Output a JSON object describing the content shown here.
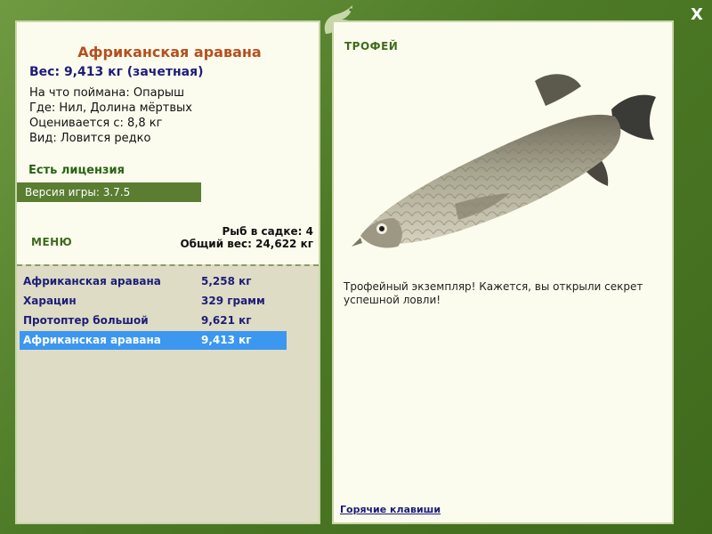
{
  "fish": {
    "name": "Африканская аравана",
    "weight_line": "Вес: 9,413 кг (зачетная)",
    "caught_on": "На что поймана: Опарыш",
    "location": "Где: Нил, Долина мёртвых",
    "rated_from": "Оценивается с: 8,8 кг",
    "rarity": "Вид: Ловится редко"
  },
  "license": "Есть лицензия",
  "version": "Версия игры: 3.7.5",
  "menu_label": "МЕНЮ",
  "keepnet": {
    "count_line": "Рыб в садке: 4",
    "total_line": "Общий вес: 24,622 кг"
  },
  "catches": [
    {
      "name": "Африканская аравана",
      "weight": "5,258 кг"
    },
    {
      "name": "Харацин",
      "weight": "329 грамм"
    },
    {
      "name": "Протоптер большой",
      "weight": "9,621 кг"
    },
    {
      "name": "Африканская аравана",
      "weight": "9,413 кг"
    }
  ],
  "selected_catch_index": 3,
  "trophy": {
    "label": "ТРОФЕЙ",
    "text": "Трофейный экземпляр! Кажется, вы открыли секрет успешной ловли!",
    "image_icon": "arowana-fish"
  },
  "hotkeys_link": "Горячие клавиши",
  "close_label": "X",
  "colors": {
    "frame_green": "#4e7a28",
    "panel_bg": "#fcfcee",
    "fish_name": "#b5501f",
    "text_navy": "#1d1d7a",
    "selection": "#3b97f0",
    "version_bar": "#5a7d32"
  }
}
